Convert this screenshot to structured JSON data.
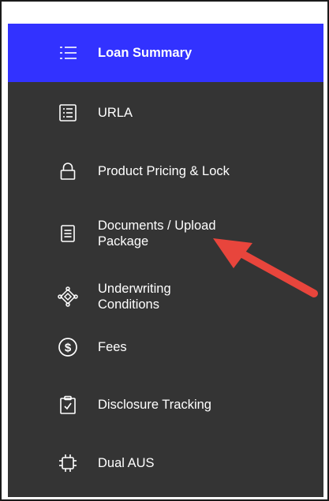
{
  "sidebar": {
    "items": [
      {
        "label": "Loan Summary",
        "icon": "list-icon",
        "active": true
      },
      {
        "label": "URLA",
        "icon": "form-document-icon"
      },
      {
        "label": "Product Pricing & Lock",
        "icon": "lock-icon"
      },
      {
        "label_lines": [
          "Documents / Upload",
          "Package"
        ],
        "icon": "document-icon"
      },
      {
        "label_lines": [
          "Underwriting",
          "Conditions"
        ],
        "icon": "network-diamond-icon"
      },
      {
        "label": "Fees",
        "icon": "dollar-circle-icon"
      },
      {
        "label": "Disclosure Tracking",
        "icon": "clipboard-check-icon"
      },
      {
        "label": "Dual AUS",
        "icon": "chip-icon"
      }
    ]
  },
  "colors": {
    "sidebar_bg": "#343434",
    "active_bg": "#3232ff",
    "text": "#ffffff",
    "arrow": "#e8453c"
  }
}
